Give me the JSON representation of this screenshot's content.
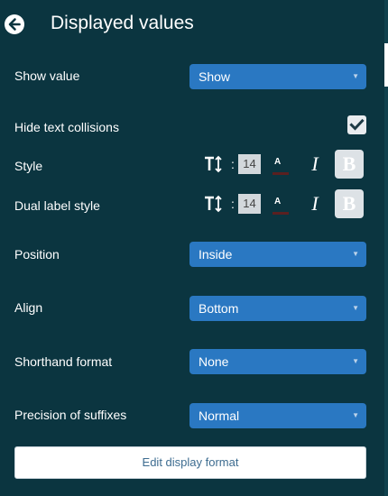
{
  "header": {
    "title": "Displayed values"
  },
  "rows": {
    "show_value": {
      "label": "Show value",
      "selected": "Show"
    },
    "hide_collisions": {
      "label": "Hide text collisions",
      "checked": true
    },
    "style": {
      "label": "Style",
      "font_size": "14",
      "color_letter": "A",
      "italic_glyph": "I",
      "bold_glyph": "B"
    },
    "dual_style": {
      "label": "Dual label style",
      "font_size": "14",
      "color_letter": "A",
      "italic_glyph": "I",
      "bold_glyph": "B"
    },
    "position": {
      "label": "Position",
      "selected": "Inside"
    },
    "align": {
      "label": "Align",
      "selected": "Bottom"
    },
    "shorthand": {
      "label": "Shorthand format",
      "selected": "None"
    },
    "precision": {
      "label": "Precision of suffixes",
      "selected": "Normal"
    }
  },
  "caret": "▼",
  "colon": ":",
  "edit_button": {
    "label": "Edit display format"
  },
  "colors": {
    "background": "#0b3540",
    "select": "#2a78c2",
    "checkbox": "#e9ecef",
    "text_color_swatch": "#5a2020"
  },
  "icons": {
    "back": "back-arrow-circle-icon",
    "text_size": "text-size-icon",
    "checkmark": "checkmark-icon",
    "caret": "chevron-down-icon"
  }
}
